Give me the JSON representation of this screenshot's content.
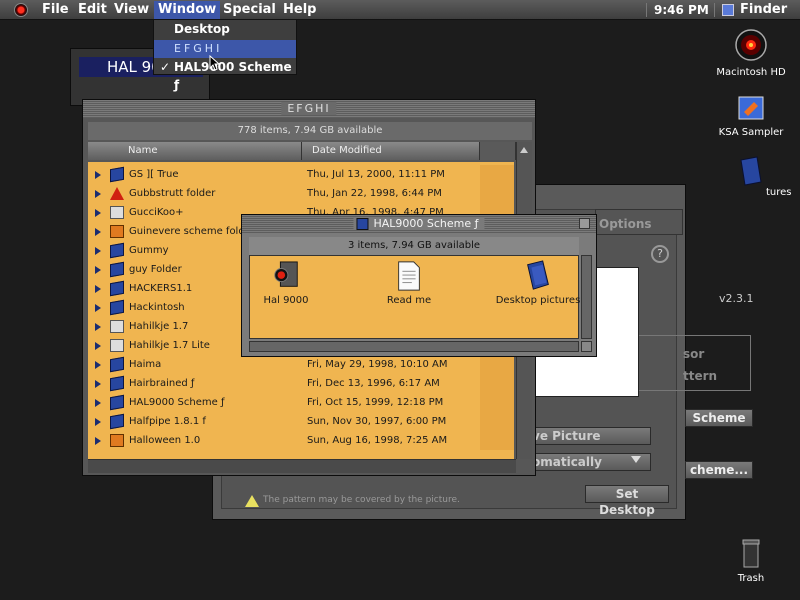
{
  "menubar": {
    "items": [
      "File",
      "Edit",
      "View",
      "Window",
      "Special",
      "Help"
    ],
    "clock": "9:46 PM",
    "app": "Finder"
  },
  "window_menu": {
    "items": [
      {
        "label": "Desktop",
        "checked": false
      },
      {
        "label": "EFGHI",
        "checked": false,
        "highlighted": true
      },
      {
        "label": "HAL9000 Scheme ƒ",
        "checked": true
      }
    ]
  },
  "desktop_icons": [
    {
      "name": "Macintosh HD",
      "icon": "hal-eye-disk-icon"
    },
    {
      "name": "KSA Sampler",
      "icon": "app-icon"
    },
    {
      "name": "tures",
      "icon": "folder-icon"
    },
    {
      "name": "Trash",
      "icon": "trash-icon"
    }
  ],
  "hal_back_window": {
    "label": "HAL 90"
  },
  "efghi": {
    "title": "EFGHI",
    "status": "778 items, 7.94 GB available",
    "columns": {
      "name": "Name",
      "date": "Date Modified"
    },
    "rows": [
      {
        "name": "GS ][ True",
        "date": "Thu, Jul 13, 2000, 11:11 PM",
        "icon": "folder"
      },
      {
        "name": "Gubbstrutt folder",
        "date": "Thu, Jan 22, 1998, 6:44 PM",
        "icon": "warn"
      },
      {
        "name": "GucciKoo+",
        "date": "Thu, Apr 16, 1998, 4:47 PM",
        "icon": "doc"
      },
      {
        "name": "Guinevere scheme folde",
        "date": "",
        "icon": "app"
      },
      {
        "name": "Gummy",
        "date": "",
        "icon": "folder"
      },
      {
        "name": "guy Folder",
        "date": "",
        "icon": "folder"
      },
      {
        "name": "HACKERS1.1",
        "date": "",
        "icon": "folder"
      },
      {
        "name": "Hackintosh",
        "date": "",
        "icon": "folder"
      },
      {
        "name": "Hahilkje 1.7",
        "date": "",
        "icon": "doc"
      },
      {
        "name": "Hahilkje 1.7 Lite",
        "date": "",
        "icon": "doc"
      },
      {
        "name": "Haima",
        "date": "Fri, May 29, 1998, 10:10 AM",
        "icon": "folder"
      },
      {
        "name": "Hairbrained ƒ",
        "date": "Fri, Dec 13, 1996, 6:17 AM",
        "icon": "folder"
      },
      {
        "name": "HAL9000 Scheme ƒ",
        "date": "Fri, Oct 15, 1999, 12:18 PM",
        "icon": "folder"
      },
      {
        "name": "Halfpipe 1.8.1 f",
        "date": "Sun, Nov 30, 1997, 6:00 PM",
        "icon": "folder"
      },
      {
        "name": "Halloween 1.0",
        "date": "Sun, Aug 16, 1998, 7:25 AM",
        "icon": "app"
      }
    ]
  },
  "scheme_window": {
    "title": "HAL9000 Scheme ƒ",
    "status": "3 items, 7.94 GB available",
    "items": [
      {
        "name": "Hal 9000",
        "icon": "hal-app-icon"
      },
      {
        "name": "Read me",
        "icon": "document-icon"
      },
      {
        "name": "Desktop pictures",
        "icon": "folder-icon"
      }
    ]
  },
  "control_panel": {
    "tab": "Options",
    "version": "v2.3.1",
    "sor": "sor",
    "pattern": "ttern",
    "scheme_button": "Scheme",
    "scheme_dots_button": "cheme...",
    "remove_picture": "ve Picture",
    "position": "omatically",
    "set_desktop": "Set Desktop",
    "warning": "The pattern may be covered by the picture."
  }
}
